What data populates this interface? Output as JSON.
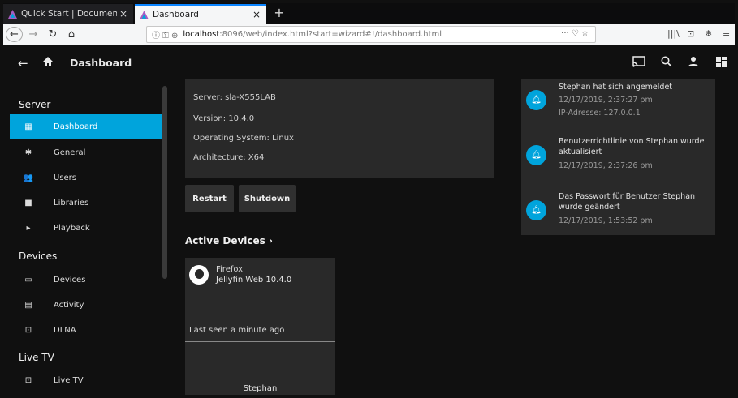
{
  "browser": {
    "tabs": [
      {
        "title": "Quick Start | Documenta",
        "close": "×",
        "active": false
      },
      {
        "title": "Dashboard",
        "close": "×",
        "active": true
      }
    ],
    "new_tab": "+",
    "url": {
      "prefix": "ⓘ ⚿ ⊕",
      "host": "localhost",
      "rest": ":8096/web/index.html?start=wizard#!/dashboard.html",
      "more": "··· ♡ ☆"
    },
    "nav": {
      "back": "←",
      "forward": "→",
      "reload": "↻",
      "home": "⌂"
    },
    "toolbar_right": [
      "|||\\",
      "⊡",
      "❄",
      "≡"
    ]
  },
  "header": {
    "title": "Dashboard"
  },
  "sidebar": {
    "sections": [
      {
        "title": "Server",
        "items": [
          {
            "label": "Dashboard",
            "icon": "▦",
            "active": true
          },
          {
            "label": "General",
            "icon": "✱"
          },
          {
            "label": "Users",
            "icon": "👥"
          },
          {
            "label": "Libraries",
            "icon": "■"
          },
          {
            "label": "Playback",
            "icon": "▸"
          }
        ]
      },
      {
        "title": "Devices",
        "items": [
          {
            "label": "Devices",
            "icon": "▭"
          },
          {
            "label": "Activity",
            "icon": "▤"
          },
          {
            "label": "DLNA",
            "icon": "⊡"
          }
        ]
      },
      {
        "title": "Live TV",
        "items": [
          {
            "label": "Live TV",
            "icon": "⊡"
          }
        ]
      }
    ]
  },
  "server": {
    "name": "Server: sla-X555LAB",
    "version": "Version: 10.4.0",
    "os": "Operating System: Linux",
    "arch": "Architecture: X64",
    "restart": "Restart",
    "shutdown": "Shutdown"
  },
  "active_devices": {
    "title": "Active Devices ›",
    "device": {
      "name": "Firefox",
      "client": "Jellyfin Web 10.4.0",
      "last_seen": "Last seen a minute ago",
      "user": "Stephan"
    }
  },
  "activity": [
    {
      "text": "Stephan hat sich angemeldet",
      "lines": [
        "12/17/2019, 2:37:27 pm",
        "IP-Adresse: 127.0.0.1"
      ]
    },
    {
      "text": "Benutzerrichtlinie von Stephan wurde aktualisiert",
      "lines": [
        "12/17/2019, 2:37:26 pm"
      ]
    },
    {
      "text": "Das Passwort für Benutzer Stephan wurde geändert",
      "lines": [
        "12/17/2019, 1:53:52 pm"
      ]
    }
  ],
  "colors": {
    "accent": "#00a4dc",
    "background": "#101010",
    "card": "#292929"
  }
}
